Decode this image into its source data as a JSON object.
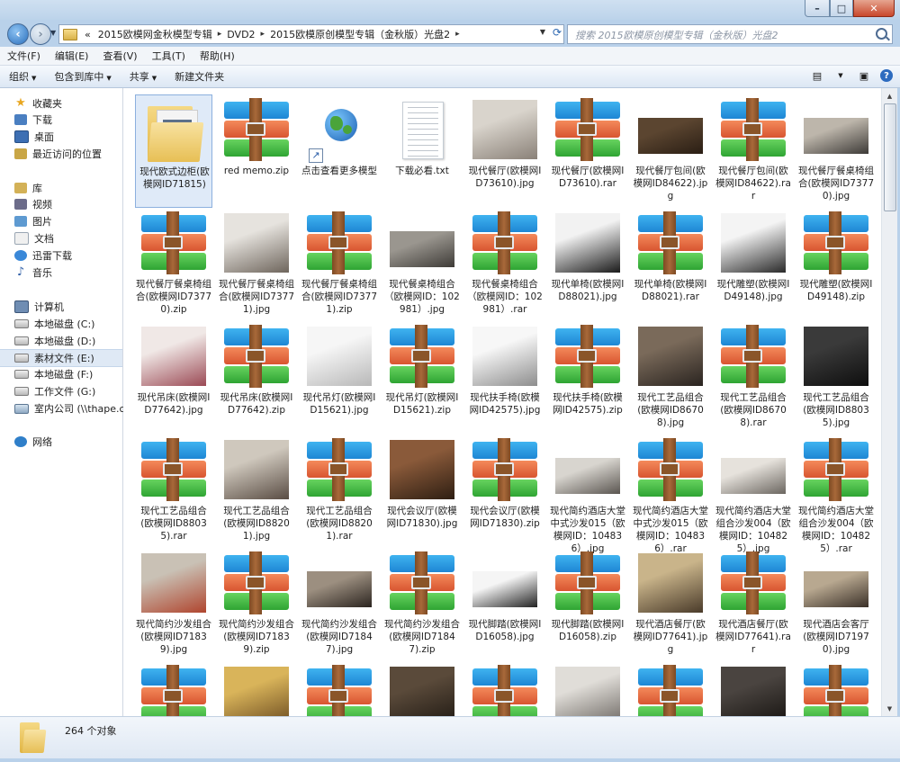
{
  "window": {
    "controls": {
      "minimize": "–",
      "maximize": "□",
      "close": "✕"
    }
  },
  "address": {
    "overflow": "«",
    "crumbs": [
      "2015欧模网金秋模型专辑",
      "DVD2",
      "2015欧模原创模型专辑（金秋版）光盘2"
    ],
    "separator": "▸"
  },
  "search": {
    "placeholder": "搜索 2015欧模原创模型专辑（金秋版）光盘2"
  },
  "menu": [
    "文件(F)",
    "编辑(E)",
    "查看(V)",
    "工具(T)",
    "帮助(H)"
  ],
  "toolbar": {
    "organize": "组织",
    "include": "包含到库中",
    "share": "共享",
    "new_folder": "新建文件夹"
  },
  "nav": {
    "favorites": "收藏夹",
    "downloads": "下载",
    "desktop": "桌面",
    "recent": "最近访问的位置",
    "libraries": "库",
    "videos": "视频",
    "pictures": "图片",
    "documents": "文档",
    "thunder": "迅雷下载",
    "music": "音乐",
    "computer": "计算机",
    "drive_c": "本地磁盘 (C:)",
    "drive_d": "本地磁盘 (D:)",
    "drive_e": "素材文件 (E:)",
    "drive_f": "本地磁盘 (F:)",
    "drive_g": "工作文件 (G:)",
    "drive_net": "室内公司 (\\\\thape.c",
    "network": "网络"
  },
  "files": [
    {
      "name": "现代欧式边柜(欧模网ID71815)",
      "type": "folder",
      "selected": true
    },
    {
      "name": "red memo.zip",
      "type": "rar"
    },
    {
      "name": "点击查看更多模型",
      "type": "link"
    },
    {
      "name": "下载必看.txt",
      "type": "txt"
    },
    {
      "name": "现代餐厅(欧模网ID73610).jpg",
      "type": "img",
      "colors": [
        "#d9d4cc",
        "#8a8178"
      ]
    },
    {
      "name": "现代餐厅(欧模网ID73610).rar",
      "type": "rar"
    },
    {
      "name": "现代餐厅包间(欧模网ID84622).jpg",
      "type": "img",
      "colors": [
        "#5b4530",
        "#2a1e14"
      ],
      "small": true
    },
    {
      "name": "现代餐厅包间(欧模网ID84622).rar",
      "type": "rar"
    },
    {
      "name": "现代餐厅餐桌椅组合(欧模网ID73770).jpg",
      "type": "img",
      "colors": [
        "#bdb6ab",
        "#3d3a37"
      ],
      "small": true
    },
    {
      "name": "现代餐厅餐桌椅组合(欧模网ID73770).zip",
      "type": "rar"
    },
    {
      "name": "现代餐厅餐桌椅组合(欧模网ID73771).jpg",
      "type": "img",
      "colors": [
        "#e6e3de",
        "#6e655c"
      ]
    },
    {
      "name": "现代餐厅餐桌椅组合(欧模网ID73771).zip",
      "type": "rar"
    },
    {
      "name": "现代餐桌椅组合（欧模网ID：102981）.jpg",
      "type": "img",
      "colors": [
        "#9a968f",
        "#3e3b37"
      ],
      "small": true
    },
    {
      "name": "现代餐桌椅组合（欧模网ID：102981）.rar",
      "type": "rar"
    },
    {
      "name": "现代单椅(欧模网ID88021).jpg",
      "type": "img",
      "colors": [
        "#f2f2f2",
        "#1a1a1a"
      ]
    },
    {
      "name": "现代单椅(欧模网ID88021).rar",
      "type": "rar"
    },
    {
      "name": "现代雕塑(欧模网ID49148).jpg",
      "type": "img",
      "colors": [
        "#f4f4f4",
        "#2a2a2a"
      ]
    },
    {
      "name": "现代雕塑(欧模网ID49148).zip",
      "type": "rar"
    },
    {
      "name": "现代吊床(欧模网ID77642).jpg",
      "type": "img",
      "colors": [
        "#f0e8e6",
        "#9b4a55"
      ]
    },
    {
      "name": "现代吊床(欧模网ID77642).zip",
      "type": "rar"
    },
    {
      "name": "现代吊灯(欧模网ID15621).jpg",
      "type": "img",
      "colors": [
        "#f6f6f6",
        "#b8b8b8"
      ]
    },
    {
      "name": "现代吊灯(欧模网ID15621).zip",
      "type": "rar"
    },
    {
      "name": "现代扶手椅(欧模网ID42575).jpg",
      "type": "img",
      "colors": [
        "#f7f7f7",
        "#8d8d8d"
      ]
    },
    {
      "name": "现代扶手椅(欧模网ID42575).zip",
      "type": "rar"
    },
    {
      "name": "现代工艺品组合(欧模网ID86708).jpg",
      "type": "img",
      "colors": [
        "#7a6a5a",
        "#2a2420"
      ]
    },
    {
      "name": "现代工艺品组合(欧模网ID86708).rar",
      "type": "rar"
    },
    {
      "name": "现代工艺品组合(欧模网ID88035).jpg",
      "type": "img",
      "colors": [
        "#3a3a3a",
        "#0e0e0e"
      ]
    },
    {
      "name": "现代工艺品组合(欧模网ID88035).rar",
      "type": "rar"
    },
    {
      "name": "现代工艺品组合(欧模网ID88201).jpg",
      "type": "img",
      "colors": [
        "#cfc8bd",
        "#5a4d44"
      ]
    },
    {
      "name": "现代工艺品组合(欧模网ID88201).rar",
      "type": "rar"
    },
    {
      "name": "现代会议厅(欧模网ID71830).jpg",
      "type": "img",
      "colors": [
        "#8a5a3a",
        "#2e1e12"
      ]
    },
    {
      "name": "现代会议厅(欧模网ID71830).zip",
      "type": "rar"
    },
    {
      "name": "现代简约酒店大堂中式沙发015（欧模网ID：104836）.jpg",
      "type": "img",
      "colors": [
        "#d8d5cf",
        "#5a5550"
      ],
      "small": true
    },
    {
      "name": "现代简约酒店大堂中式沙发015（欧模网ID：104836）.rar",
      "type": "rar"
    },
    {
      "name": "现代简约酒店大堂组合沙发004（欧模网ID：104825）.jpg",
      "type": "img",
      "colors": [
        "#e6e2dc",
        "#6b6660"
      ],
      "small": true
    },
    {
      "name": "现代简约酒店大堂组合沙发004（欧模网ID：104825）.rar",
      "type": "rar"
    },
    {
      "name": "现代简约沙发组合(欧模网ID71839).jpg",
      "type": "img",
      "colors": [
        "#c9c1b5",
        "#b0452e"
      ]
    },
    {
      "name": "现代简约沙发组合(欧模网ID71839).zip",
      "type": "rar"
    },
    {
      "name": "现代简约沙发组合(欧模网ID71847).jpg",
      "type": "img",
      "colors": [
        "#9c8f80",
        "#2c2520"
      ],
      "small": true
    },
    {
      "name": "现代简约沙发组合(欧模网ID71847).zip",
      "type": "rar"
    },
    {
      "name": "现代脚踏(欧模网ID16058).jpg",
      "type": "img",
      "colors": [
        "#f5f5f5",
        "#222222"
      ],
      "small": true
    },
    {
      "name": "现代脚踏(欧模网ID16058).zip",
      "type": "rar"
    },
    {
      "name": "现代酒店餐厅(欧模网ID77641).jpg",
      "type": "img",
      "colors": [
        "#c9b48a",
        "#4a3b2a"
      ]
    },
    {
      "name": "现代酒店餐厅(欧模网ID77641).rar",
      "type": "rar"
    },
    {
      "name": "现代酒店会客厅(欧模网ID71970).jpg",
      "type": "img",
      "colors": [
        "#b8a890",
        "#3a3028"
      ],
      "small": true
    },
    {
      "name": "",
      "type": "rar"
    },
    {
      "name": "",
      "type": "img",
      "colors": [
        "#d9b45a",
        "#6a4a20"
      ]
    },
    {
      "name": "",
      "type": "rar"
    },
    {
      "name": "",
      "type": "img",
      "colors": [
        "#5a4a3a",
        "#1e1812"
      ]
    },
    {
      "name": "",
      "type": "rar"
    },
    {
      "name": "",
      "type": "img",
      "colors": [
        "#e0ddd8",
        "#6a6560"
      ]
    },
    {
      "name": "",
      "type": "rar"
    },
    {
      "name": "",
      "type": "img",
      "colors": [
        "#4a4440",
        "#15120f"
      ]
    },
    {
      "name": "",
      "type": "rar"
    }
  ],
  "status": {
    "count": "264 个对象"
  }
}
